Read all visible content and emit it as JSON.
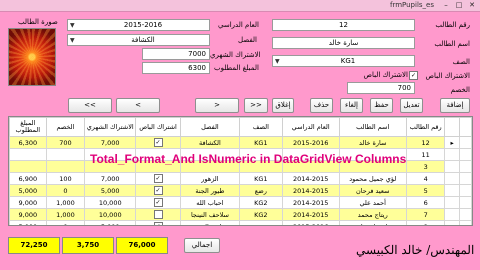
{
  "window": {
    "title": "frmPupils_es"
  },
  "labels": {
    "student_id": "رقم الطالب",
    "student_name": "اسم الطالب",
    "class": "الصف",
    "special_subscription": "الاشتراك الباص",
    "discount": "الخصم",
    "academic_year": "العام الدراسي",
    "section": "الفصل",
    "monthly_subscription": "الاشتراك الشهري",
    "amount_due": "المبلغ المطلوب",
    "student_photo": "صورة الطالب"
  },
  "form": {
    "student_id": "12",
    "student_name": "سارة خالد",
    "class": "KG1",
    "special_checkbox_label": "الاشتراك الباص",
    "discount": "700",
    "academic_year": "2015-2016",
    "section": "الكشافة",
    "monthly_subscription": "7000",
    "amount_due": "6300"
  },
  "buttons": {
    "add": "إضافة",
    "edit": "تعديل",
    "save": "حفظ",
    "cancel": "إلغاء",
    "delete": "حذف",
    "close": "إغلاق",
    "first": "<<",
    "prev": "<",
    "next": ">",
    "last": ">>",
    "total": "اجمالي"
  },
  "grid": {
    "columns": [
      "رقم الطالب",
      "اسم الطالب",
      "العام الدراسي",
      "الصف",
      "الفصل",
      "اشتراك الباص",
      "الاشتراك الشهري",
      "الخصم",
      "المبلغ المطلوب"
    ],
    "rows": [
      {
        "marker": "▸",
        "id": "12",
        "name": "سارة خالد",
        "year": "2015-2016",
        "class": "KG1",
        "section": "الكشافة",
        "checked": true,
        "monthly": "7,000",
        "discount": "700",
        "due": "6,300",
        "style": "sel"
      },
      {
        "marker": "",
        "id": "11",
        "name": "",
        "year": "",
        "class": "",
        "section": "",
        "checked": false,
        "monthly": "",
        "discount": "",
        "due": "",
        "style": "white"
      },
      {
        "marker": "",
        "id": "3",
        "name": "",
        "year": "",
        "class": "",
        "section": "",
        "checked": false,
        "monthly": "",
        "discount": "",
        "due": "",
        "style": "yellow"
      },
      {
        "marker": "",
        "id": "4",
        "name": "لؤي جميل محمود",
        "year": "2014-2015",
        "class": "KG1",
        "section": "الزهور",
        "checked": true,
        "monthly": "7,000",
        "discount": "100",
        "due": "6,900",
        "style": "white"
      },
      {
        "marker": "",
        "id": "5",
        "name": "سعيد فرحان",
        "year": "2014-2015",
        "class": "رضع",
        "section": "طيور الجنة",
        "checked": true,
        "monthly": "5,000",
        "discount": "0",
        "due": "5,000",
        "style": "yellow"
      },
      {
        "marker": "",
        "id": "6",
        "name": "أحمد علي",
        "year": "2014-2015",
        "class": "KG2",
        "section": "احباب الله",
        "checked": true,
        "monthly": "10,000",
        "discount": "1,000",
        "due": "9,000",
        "style": "white"
      },
      {
        "marker": "",
        "id": "7",
        "name": "ريتاج محمد",
        "year": "2014-2015",
        "class": "KG2",
        "section": "سلاحف النينجا",
        "checked": false,
        "monthly": "10,000",
        "discount": "1,000",
        "due": "9,000",
        "style": "yellow"
      },
      {
        "marker": "",
        "id": "8",
        "name": "مرام علي قاسم",
        "year": "2015-2016",
        "class": "رضع",
        "section": "طيور الجنة",
        "checked": true,
        "monthly": "5,000",
        "discount": "0",
        "due": "5,000",
        "style": "white"
      }
    ]
  },
  "overlay_title": "Total_Format_And IsNumeric in DataGridView Columns",
  "totals": {
    "due": "72,250",
    "discount": "3,750",
    "monthly": "76,000"
  },
  "signature": "المهندس/ خالد الكبيسي",
  "colors": {
    "background": "#ff99cc",
    "row_highlight": "#ffff99",
    "overlay_text": "#e0007a",
    "total_fill": "#ffff00"
  }
}
